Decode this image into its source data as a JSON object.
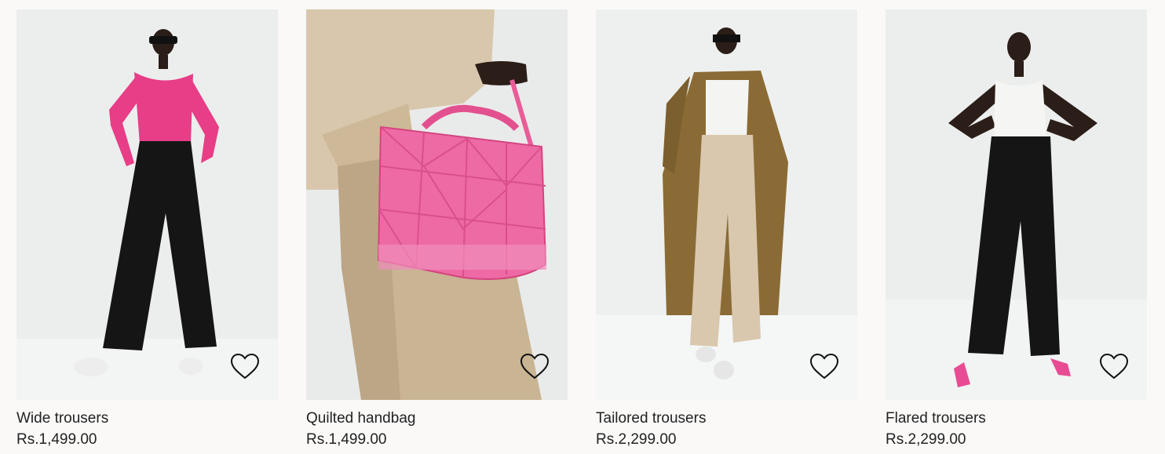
{
  "products": [
    {
      "name": "Wide trousers",
      "price": "Rs.1,499.00",
      "favorite_icon": "heart-outline-icon"
    },
    {
      "name": "Quilted handbag",
      "price": "Rs.1,499.00",
      "favorite_icon": "heart-outline-icon"
    },
    {
      "name": "Tailored trousers",
      "price": "Rs.2,299.00",
      "favorite_icon": "heart-outline-icon"
    },
    {
      "name": "Flared trousers",
      "price": "Rs.2,299.00",
      "favorite_icon": "heart-outline-icon"
    }
  ],
  "colors": {
    "background": "#faf9f8",
    "photo_bg": "#eceeed",
    "text": "#222222",
    "pink": "#ea3f8a",
    "black": "#1a1a1a",
    "beige": "#d8c7ad",
    "camel": "#8a6a35"
  }
}
